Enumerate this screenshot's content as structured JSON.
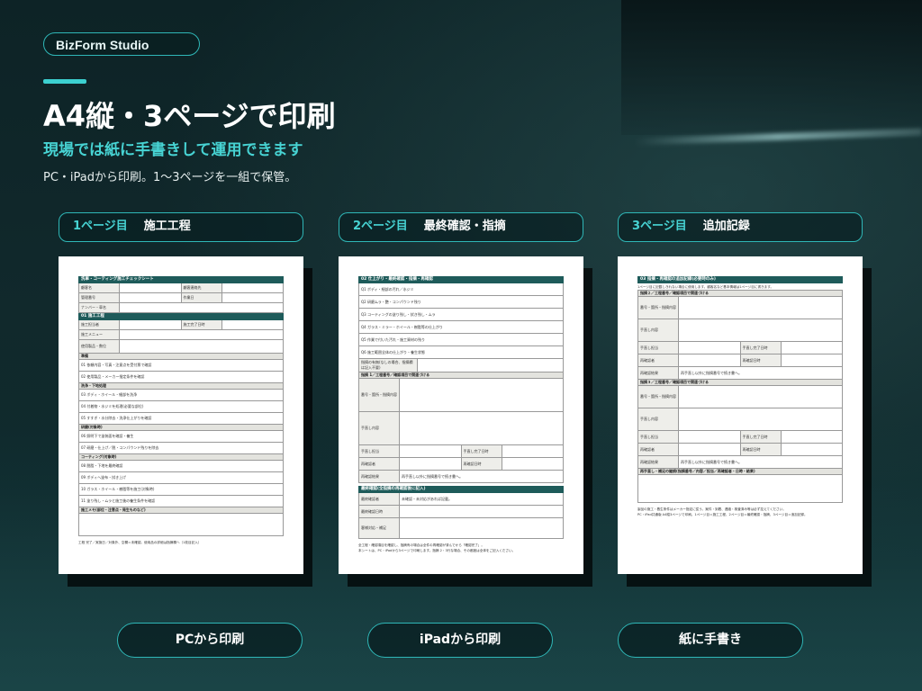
{
  "brand": "BizForm Studio",
  "header": {
    "title": "A4縦・3ページで印刷",
    "subtitle": "現場では紙に手書きして運用できます",
    "description": "PC・iPadから印刷。1〜3ページを一組で保管。"
  },
  "pages": [
    {
      "num_label": "1ページ目",
      "name": "施工工程",
      "sheet": {
        "title": "洗車・コーティング施工チェックシート",
        "top_rows": [
          [
            "顧客名",
            "顧客連絡先"
          ],
          [
            "管理番号",
            "作業日"
          ],
          [
            "ナンバー・車名",
            ""
          ]
        ],
        "section_title": "01 施工工程",
        "info_rows": [
          [
            "施工担当者",
            "施工完了日時"
          ],
          [
            "施工メニュー",
            ""
          ],
          [
            "使用製品・数位",
            ""
          ]
        ],
        "groups": [
          {
            "name": "準備",
            "items": [
              "01 依頼内容・写真・注意点を受付票で確認",
              "02 使用製品・メーカー指定条件を確認"
            ]
          },
          {
            "name": "洗浄・下地処理",
            "items": [
              "03 ボディ・ホイール・細部を洗浄",
              "04 付着物・水ジミを処理(必要な部位)",
              "05 すすぎ・水分除去・洗浄仕上がりを確認"
            ]
          },
          {
            "name": "研磨(対象時)",
            "items": [
              "06 照明下で塗装面を確認・養生",
              "07 研磨・仕上げ／脱・コンパウンド残りを除去"
            ]
          },
          {
            "name": "コーティング(対象時)",
            "items": [
              "08 脱脂・下地を最終確認",
              "09 ボディへ塗布・拭き上げ",
              "10 ガラス・ホイール・樹脂等を施工(対象時)",
              "11 塗り残し・ムラと施工後の養生条件を確認"
            ]
          }
        ],
        "memo_title": "施工メモ(部位・注意点・発生ものなど)",
        "footer": "工程 完了／実施日／対象外、空欄＝未確認。使用品の詳細は指摘欄へ（1枚目記入）"
      }
    },
    {
      "num_label": "2ページ目",
      "name": "最終確認・指摘",
      "sheet": {
        "title": "02 仕上がり・最終確認・指摘・再確認",
        "checks": [
          "Q1 ボディ・細部の汚れ／水ジミ",
          "Q2 研磨ムラ・艶・コンパウンド残り",
          "Q3 コーティングの塗り残し・拭き残し・ムラ",
          "Q4 ガラス・ミラー・ホイール・樹脂等の仕上がり",
          "Q5 作業で付いた汚れ・施工資材の残り",
          "Q6 施工範囲全体の仕上がり・養生状態"
        ],
        "issue_row": "指摘の有無(なしの場合、指摘欄は記入不要)",
        "issue_section": "指摘 1／工程番号／確認項目で関連づける",
        "issue_fields": [
          "番号・箇所・指摘内容",
          "手直し内容"
        ],
        "issue_pairs": [
          [
            "手直し担当",
            "手直し完了日時"
          ],
          [
            "再確認者",
            "再確認日時"
          ]
        ],
        "recheck_label": "再確認結果",
        "recheck_value": "再手直し以外に指摘番号で続き書へ。",
        "final_title": "最終確認(全指摘の再確認後に記入)",
        "final_rows": [
          [
            "最終確認者",
            "未確認・未対応があれば記載。"
          ],
          [
            "最終確認日時",
            ""
          ],
          [
            "客様対応・補足",
            ""
          ]
        ],
        "notes": [
          "全工程・確認項目を確認し、指摘有の場合は全件の再確認が済んでから「確認完了」。",
          "本シートは、PC・iPadから3ページで印刷します。指摘 2・3行な場合、その都度は全体をご記入ください。"
        ]
      }
    },
    {
      "num_label": "3ページ目",
      "name": "追加記録",
      "sheet": {
        "title": "03 指摘・再確認の追加記録(必要時のみ)",
        "intro": "1ページ目に記載しきれない場合に使用します。顧客名など基本情報は1ページ目に書きます。",
        "block1_title": "指摘２／工程番号／確認項目で関連づける",
        "block2_title": "指摘３／工程番号／確認項目で関連づける",
        "fields": [
          "番号・箇所・指摘内容",
          "手直し内容"
        ],
        "pairs": [
          [
            "手直し担当",
            "手直し完了日時"
          ],
          [
            "再確認者",
            "再確認日時"
          ]
        ],
        "recheck_label": "再確認結果",
        "recheck_value": "再手直し以外に指摘番号で続き書へ。",
        "memo_title": "再手直し・補足の継続(指摘番号／内容／担当／再確認者・日時・結果)",
        "notes": [
          "製品の施工・養生条件はメーカー指定に従う。案件・到着、連絡・検査済み等は必ず控えてください。",
          "PC・iPad共通版 A4縦3ページで印刷。1ページ目＝施工工程、2ページ目＝最終確認・指摘、3ページ目＝追加記録。"
        ]
      }
    }
  ],
  "buttons": [
    "PCから印刷",
    "iPadから印刷",
    "紙に手書き"
  ],
  "colors": {
    "accent": "#47d3d3",
    "border": "#2fb7b7",
    "sheet_header": "#1e5b5a",
    "background": "#11292c"
  }
}
